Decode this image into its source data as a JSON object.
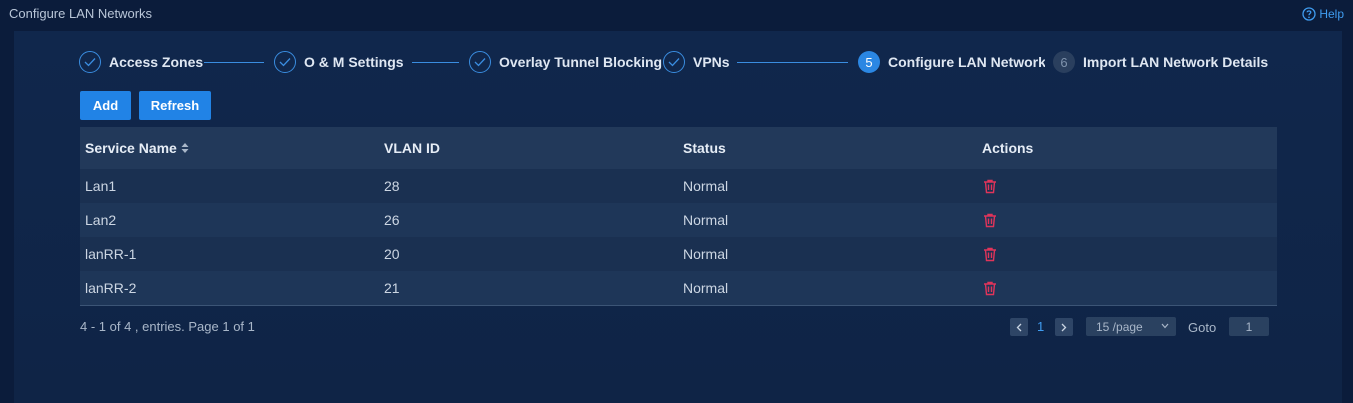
{
  "window": {
    "title": "Configure LAN Networks",
    "help_label": "Help"
  },
  "steps": [
    {
      "label": "Access Zones",
      "state": "done"
    },
    {
      "label": "O & M Settings",
      "state": "done"
    },
    {
      "label": "Overlay Tunnel Blocking",
      "state": "done"
    },
    {
      "label": "VPNs",
      "state": "done"
    },
    {
      "number": "5",
      "label": "Configure LAN Networks",
      "state": "current"
    },
    {
      "number": "6",
      "label": "Import LAN Network Details",
      "state": "pending"
    }
  ],
  "toolbar": {
    "add_label": "Add",
    "refresh_label": "Refresh"
  },
  "table": {
    "columns": [
      "Service Name",
      "VLAN ID",
      "Status",
      "Actions"
    ],
    "rows": [
      {
        "service_name": "Lan1",
        "vlan_id": "28",
        "status": "Normal"
      },
      {
        "service_name": "Lan2",
        "vlan_id": "26",
        "status": "Normal"
      },
      {
        "service_name": "lanRR-1",
        "vlan_id": "20",
        "status": "Normal"
      },
      {
        "service_name": "lanRR-2",
        "vlan_id": "21",
        "status": "Normal"
      }
    ]
  },
  "pagination": {
    "summary": "4 - 1 of 4 , entries. Page 1 of 1",
    "current_page": "1",
    "page_size": "15 /page",
    "goto_label": "Goto",
    "goto_value": "1"
  },
  "colors": {
    "accent": "#2183e6",
    "danger": "#e0345a",
    "background": "#0b1c3b"
  },
  "icons": {
    "help": "question-circle-icon",
    "done": "check-icon",
    "sort": "sort-icon",
    "delete": "trash-icon"
  }
}
